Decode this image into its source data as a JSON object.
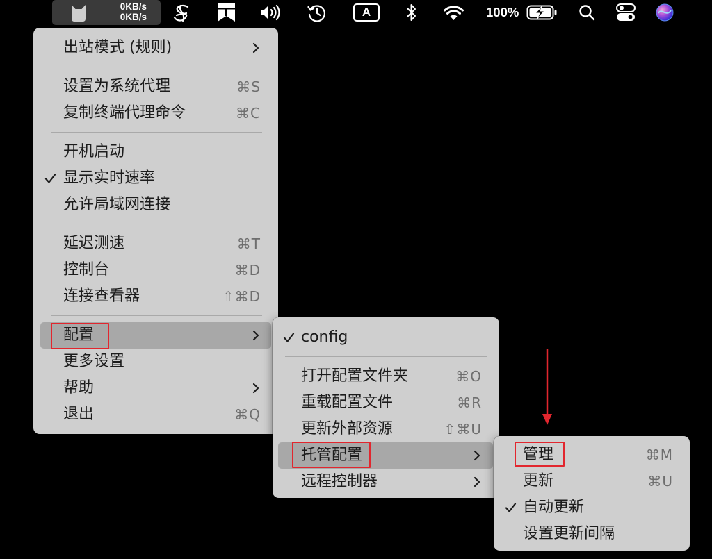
{
  "colors": {
    "menu_background": "#cfcfcf",
    "menu_highlight": "#a8a8a8",
    "menu_text": "#1c1c1c",
    "shortcut_text": "#6e6e6e",
    "annotation_red": "#e2262e",
    "menubar_highlight": "#3a3a3a"
  },
  "menu_bar": {
    "clashx": {
      "upload_speed": "0KB/s",
      "download_speed": "0KB/s"
    },
    "input_source": "A",
    "battery_percent": "100%",
    "icons": [
      "clashx-cat-icon",
      "swirl-s-icon",
      "bookmark-app-icon",
      "volume-icon",
      "time-machine-icon",
      "input-source-icon",
      "bluetooth-icon",
      "wifi-icon",
      "battery-charging-icon",
      "spotlight-search-icon",
      "control-center-icon",
      "siri-icon"
    ]
  },
  "main_menu": {
    "items": [
      {
        "label": "出站模式 (规则)",
        "submenu": true
      },
      {
        "label": "设置为系统代理",
        "shortcut": "⌘S"
      },
      {
        "label": "复制终端代理命令",
        "shortcut": "⌘C"
      },
      {
        "label": "开机启动"
      },
      {
        "label": "显示实时速率",
        "checked": true
      },
      {
        "label": "允许局域网连接"
      },
      {
        "label": "延迟测速",
        "shortcut": "⌘T"
      },
      {
        "label": "控制台",
        "shortcut": "⌘D"
      },
      {
        "label": "连接查看器",
        "shortcut": "⇧⌘D"
      },
      {
        "label": "配置",
        "submenu": true,
        "highlighted": true,
        "annotated": true
      },
      {
        "label": "更多设置"
      },
      {
        "label": "帮助",
        "submenu": true
      },
      {
        "label": "退出",
        "shortcut": "⌘Q"
      }
    ]
  },
  "config_submenu": {
    "items": [
      {
        "label": "config",
        "checked": true
      },
      {
        "label": "打开配置文件夹",
        "shortcut": "⌘O"
      },
      {
        "label": "重载配置文件",
        "shortcut": "⌘R"
      },
      {
        "label": "更新外部资源",
        "shortcut": "⇧⌘U"
      },
      {
        "label": "托管配置",
        "submenu": true,
        "highlighted": true,
        "annotated": true
      },
      {
        "label": "远程控制器",
        "submenu": true
      }
    ]
  },
  "hosted_config_submenu": {
    "items": [
      {
        "label": "管理",
        "shortcut": "⌘M",
        "annotated": true
      },
      {
        "label": "更新",
        "shortcut": "⌘U"
      },
      {
        "label": "自动更新",
        "checked": true
      },
      {
        "label": "设置更新间隔"
      }
    ]
  }
}
